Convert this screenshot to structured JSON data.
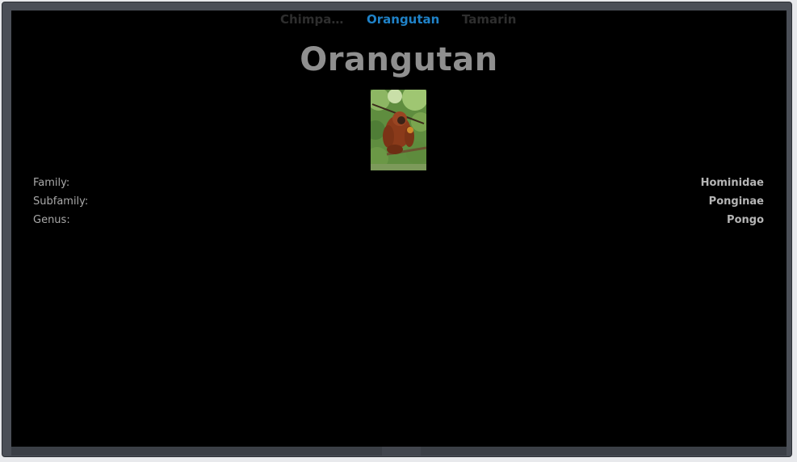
{
  "tabs": [
    {
      "label": "Chimpan...",
      "active": false
    },
    {
      "label": "Orangutan",
      "active": true
    },
    {
      "label": "Tamarin",
      "active": false
    }
  ],
  "title": "Orangutan",
  "photo_icon": "orangutan-photo",
  "taxonomy": [
    {
      "label": "Family:",
      "value": "Hominidae"
    },
    {
      "label": "Subfamily:",
      "value": "Ponginae"
    },
    {
      "label": "Genus:",
      "value": "Pongo"
    }
  ],
  "colors": {
    "accent": "#1f82c8",
    "background": "#000000",
    "title": "#8f8f8f"
  }
}
